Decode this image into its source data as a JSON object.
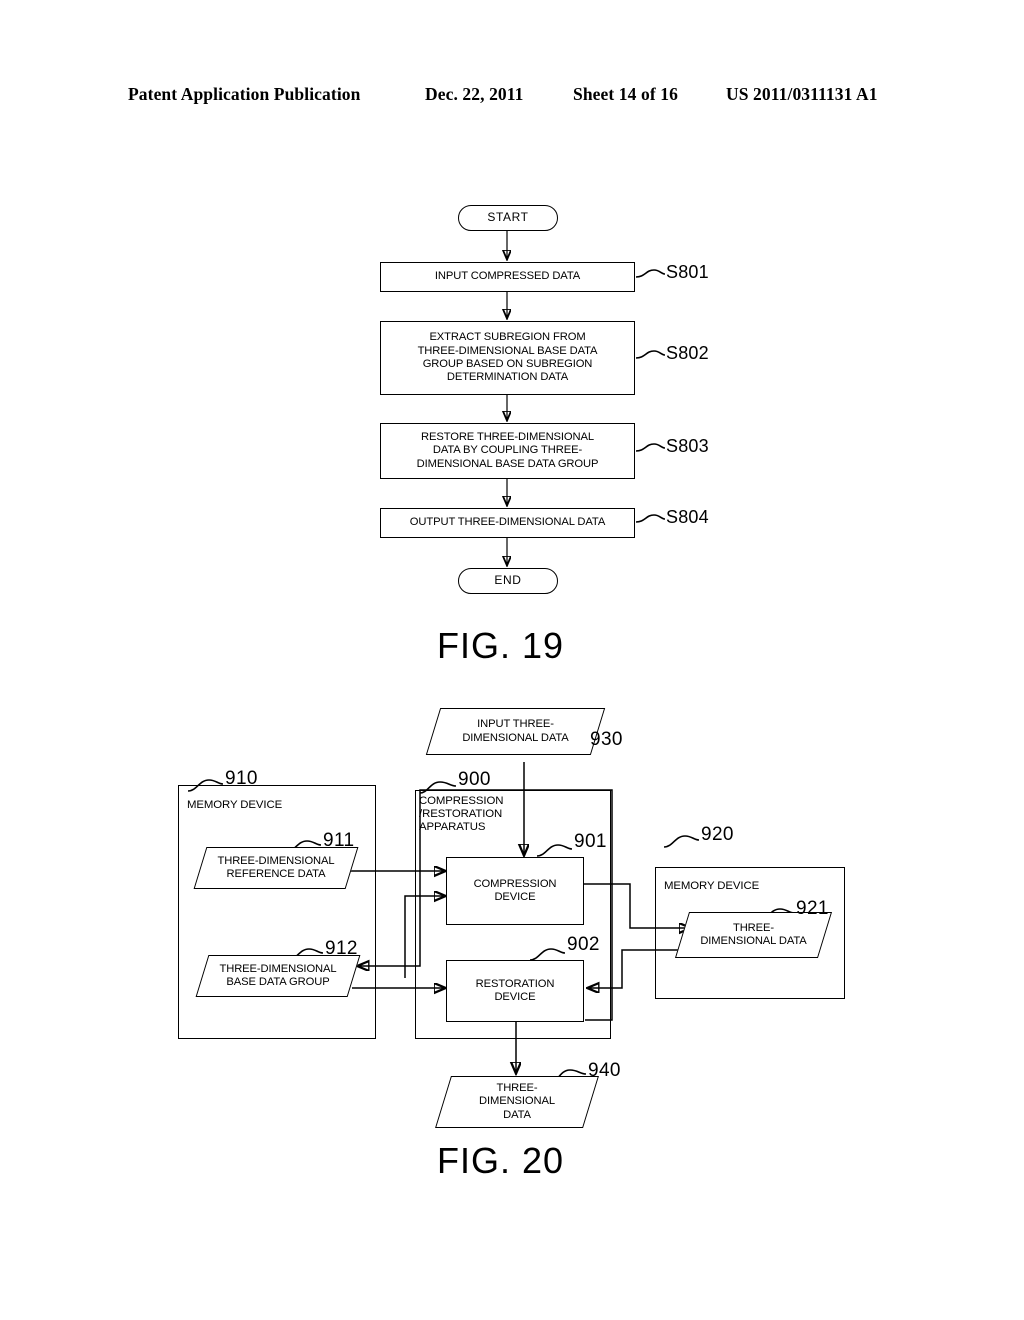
{
  "header": {
    "publication": "Patent Application Publication",
    "date": "Dec. 22, 2011",
    "sheet": "Sheet 14 of 16",
    "document_number": "US 2011/0311131 A1"
  },
  "figures": [
    {
      "caption": "FIG. 19",
      "type": "flowchart",
      "nodes": [
        {
          "id": "start",
          "shape": "terminator",
          "text": "START"
        },
        {
          "id": "s801",
          "shape": "process",
          "text": "INPUT COMPRESSED DATA",
          "step": "S801"
        },
        {
          "id": "s802",
          "shape": "process",
          "text": "EXTRACT SUBREGION FROM\nTHREE-DIMENSIONAL BASE DATA\nGROUP BASED ON SUBREGION\nDETERMINATION DATA",
          "step": "S802"
        },
        {
          "id": "s803",
          "shape": "process",
          "text": "RESTORE THREE-DIMENSIONAL\nDATA BY COUPLING THREE-\nDIMENSIONAL BASE DATA GROUP",
          "step": "S803"
        },
        {
          "id": "s804",
          "shape": "process",
          "text": "OUTPUT THREE-DIMENSIONAL DATA",
          "step": "S804"
        },
        {
          "id": "end",
          "shape": "terminator",
          "text": "END"
        }
      ],
      "flow": [
        "start",
        "s801",
        "s802",
        "s803",
        "s804",
        "end"
      ]
    },
    {
      "caption": "FIG. 20",
      "type": "block-diagram",
      "nodes": [
        {
          "id": "n930",
          "shape": "data",
          "text": "INPUT THREE-\nDIMENSIONAL DATA",
          "ref": "930"
        },
        {
          "id": "n910",
          "shape": "container",
          "text": "MEMORY DEVICE",
          "ref": "910"
        },
        {
          "id": "n911",
          "shape": "data",
          "text": "THREE-DIMENSIONAL\nREFERENCE DATA",
          "ref": "911"
        },
        {
          "id": "n912",
          "shape": "data",
          "text": "THREE-DIMENSIONAL\nBASE DATA GROUP",
          "ref": "912"
        },
        {
          "id": "n900",
          "shape": "container",
          "text": "COMPRESSION\n/RESTORATION\nAPPARATUS",
          "ref": "900"
        },
        {
          "id": "n901",
          "shape": "process",
          "text": "COMPRESSION\nDEVICE",
          "ref": "901"
        },
        {
          "id": "n902",
          "shape": "process",
          "text": "RESTORATION\nDEVICE",
          "ref": "902"
        },
        {
          "id": "n920",
          "shape": "container",
          "text": "MEMORY DEVICE",
          "ref": "920"
        },
        {
          "id": "n921",
          "shape": "data",
          "text": "THREE-\nDIMENSIONAL DATA",
          "ref": "921"
        },
        {
          "id": "n940",
          "shape": "data",
          "text": "THREE-\nDIMENSIONAL\nDATA",
          "ref": "940"
        }
      ],
      "connections": [
        {
          "from": "n930",
          "to": "n901"
        },
        {
          "from": "n911",
          "to": "n901"
        },
        {
          "from": "n912",
          "to": "n901"
        },
        {
          "from": "n912",
          "to": "n902"
        },
        {
          "from": "n901",
          "to": "n921"
        },
        {
          "from": "n921",
          "to": "n902"
        },
        {
          "from": "n902",
          "to": "n912"
        },
        {
          "from": "n902",
          "to": "n940"
        }
      ]
    }
  ]
}
